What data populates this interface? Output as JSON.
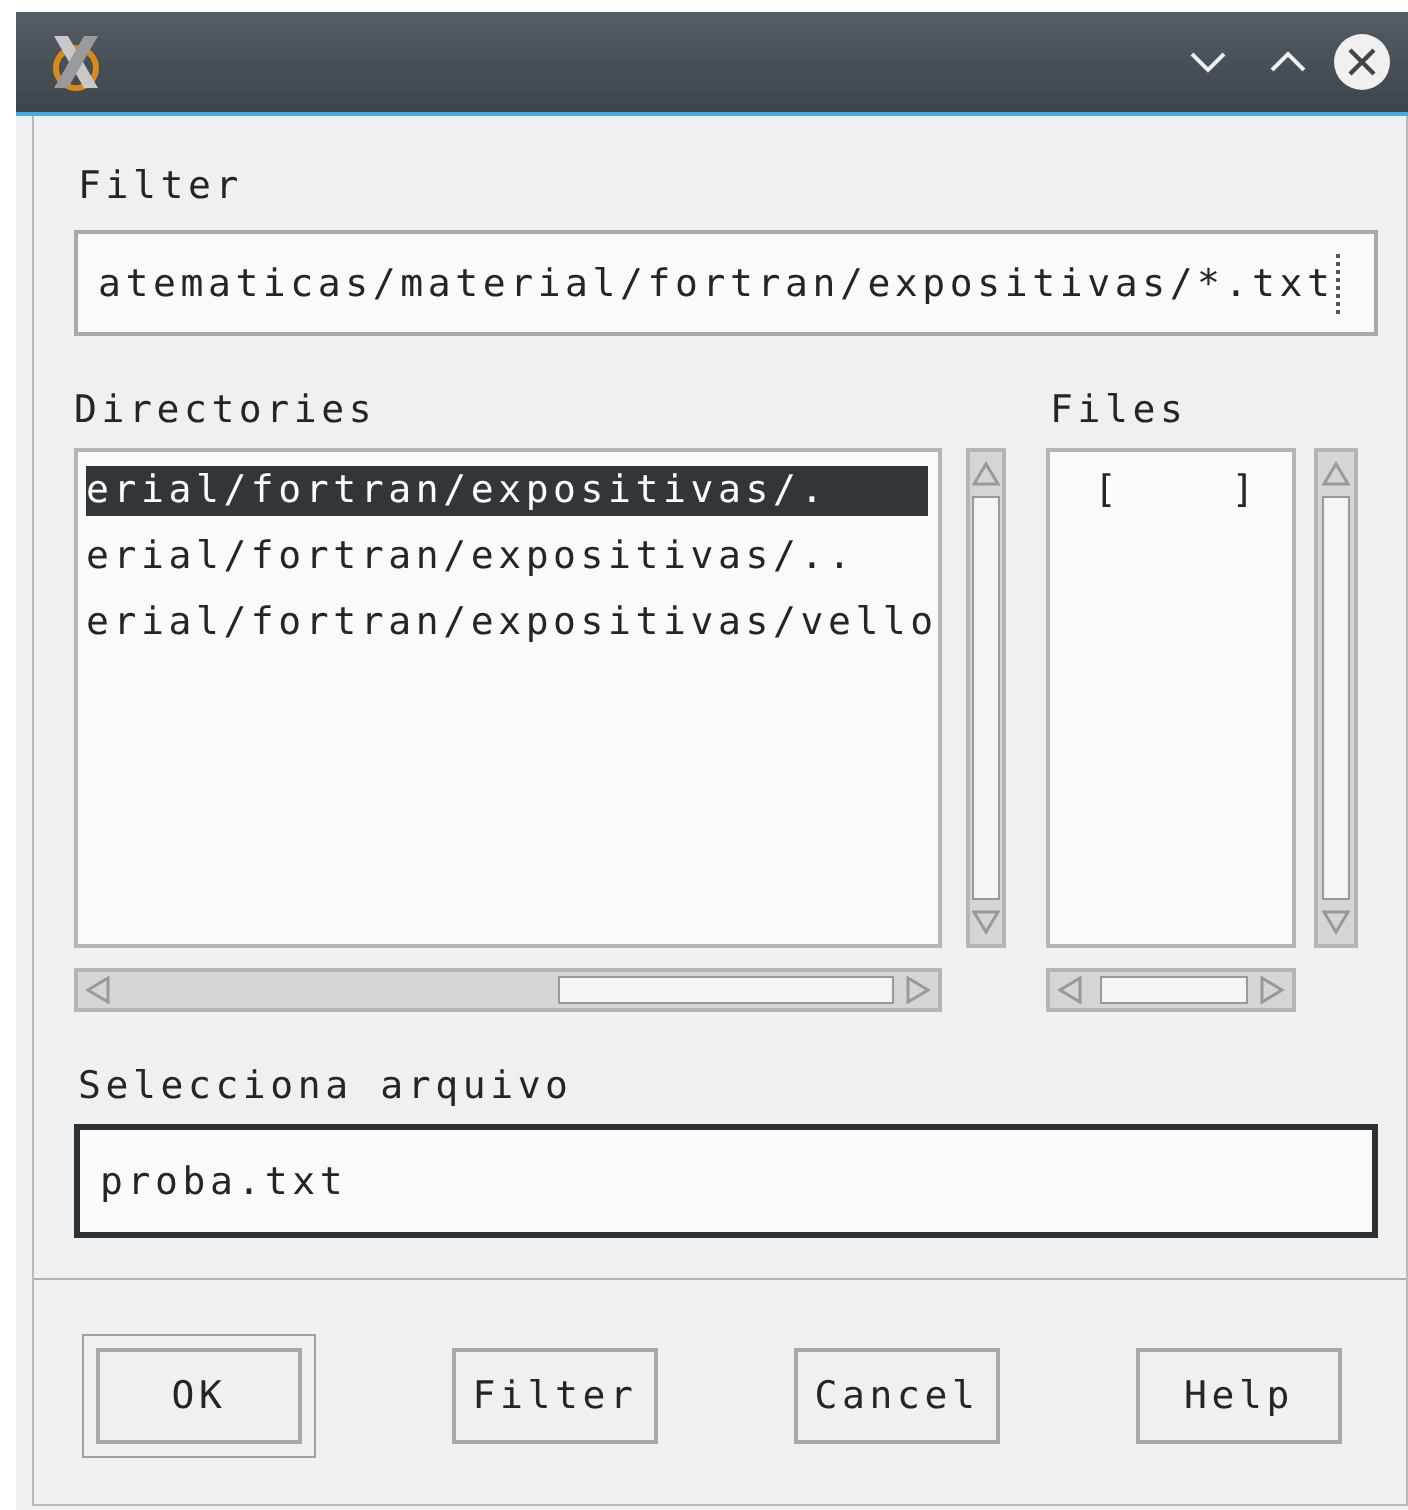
{
  "filter": {
    "label": "Filter",
    "value": "atematicas/material/fortran/expositivas/*.txt"
  },
  "directories": {
    "label": "Directories",
    "items": [
      {
        "text": "erial/fortran/expositivas/.",
        "selected": true
      },
      {
        "text": "erial/fortran/expositivas/..",
        "selected": false
      },
      {
        "text": "erial/fortran/expositivas/vello",
        "selected": false
      }
    ]
  },
  "files": {
    "label": "Files",
    "items": [
      {
        "text": "[    ]",
        "selected": false
      }
    ]
  },
  "selection": {
    "label": "Selecciona arquivo",
    "value": "proba.txt"
  },
  "buttons": [
    {
      "label": "OK",
      "default": true
    },
    {
      "label": "Filter",
      "default": false
    },
    {
      "label": "Cancel",
      "default": false
    },
    {
      "label": "Help",
      "default": false
    }
  ]
}
